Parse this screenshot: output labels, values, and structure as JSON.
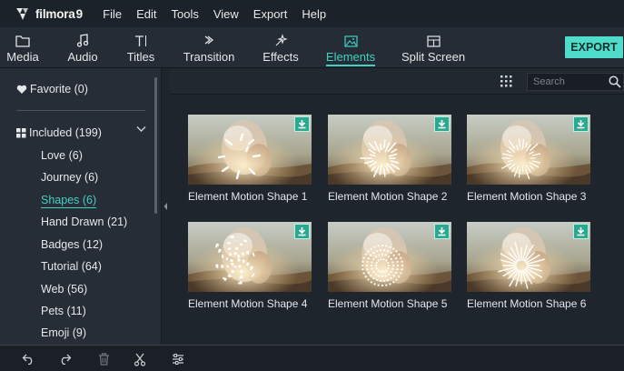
{
  "app": {
    "name": "filmora",
    "version": "9"
  },
  "menu": [
    "File",
    "Edit",
    "Tools",
    "View",
    "Export",
    "Help"
  ],
  "tabs": [
    {
      "label": "Media",
      "icon": "folder-icon",
      "active": false
    },
    {
      "label": "Audio",
      "icon": "music-note-icon",
      "active": false
    },
    {
      "label": "Titles",
      "icon": "titles-icon",
      "active": false
    },
    {
      "label": "Transition",
      "icon": "transition-icon",
      "active": false
    },
    {
      "label": "Effects",
      "icon": "effects-icon",
      "active": false
    },
    {
      "label": "Elements",
      "icon": "image-icon",
      "active": true
    },
    {
      "label": "Split Screen",
      "icon": "split-screen-icon",
      "active": false
    }
  ],
  "export_label": "EXPORT",
  "sidebar": {
    "favorite": "Favorite (0)",
    "included": "Included (199)",
    "categories": [
      "Love (6)",
      "Journey (6)",
      "Shapes (6)",
      "Hand Drawn (21)",
      "Badges (12)",
      "Tutorial (64)",
      "Web (56)",
      "Pets (11)",
      "Emoji (9)"
    ],
    "active_category": "Shapes (6)"
  },
  "search": {
    "placeholder": "Search"
  },
  "elements": [
    {
      "title": "Element Motion Shape 1",
      "shape": "dashes"
    },
    {
      "title": "Element Motion Shape 2",
      "shape": "burst"
    },
    {
      "title": "Element Motion Shape 3",
      "shape": "radial"
    },
    {
      "title": "Element Motion Shape 4",
      "shape": "dots"
    },
    {
      "title": "Element Motion Shape 5",
      "shape": "dot-ring"
    },
    {
      "title": "Element Motion Shape 6",
      "shape": "spokes"
    }
  ],
  "colors": {
    "accent": "#43d0c2",
    "export_button": "#4fdccb",
    "download_badge": "#2ba890",
    "background": "#1f252d"
  },
  "bottom_toolbar": [
    "undo-icon",
    "redo-icon",
    "delete-icon",
    "cut-icon",
    "adjust-icon"
  ]
}
